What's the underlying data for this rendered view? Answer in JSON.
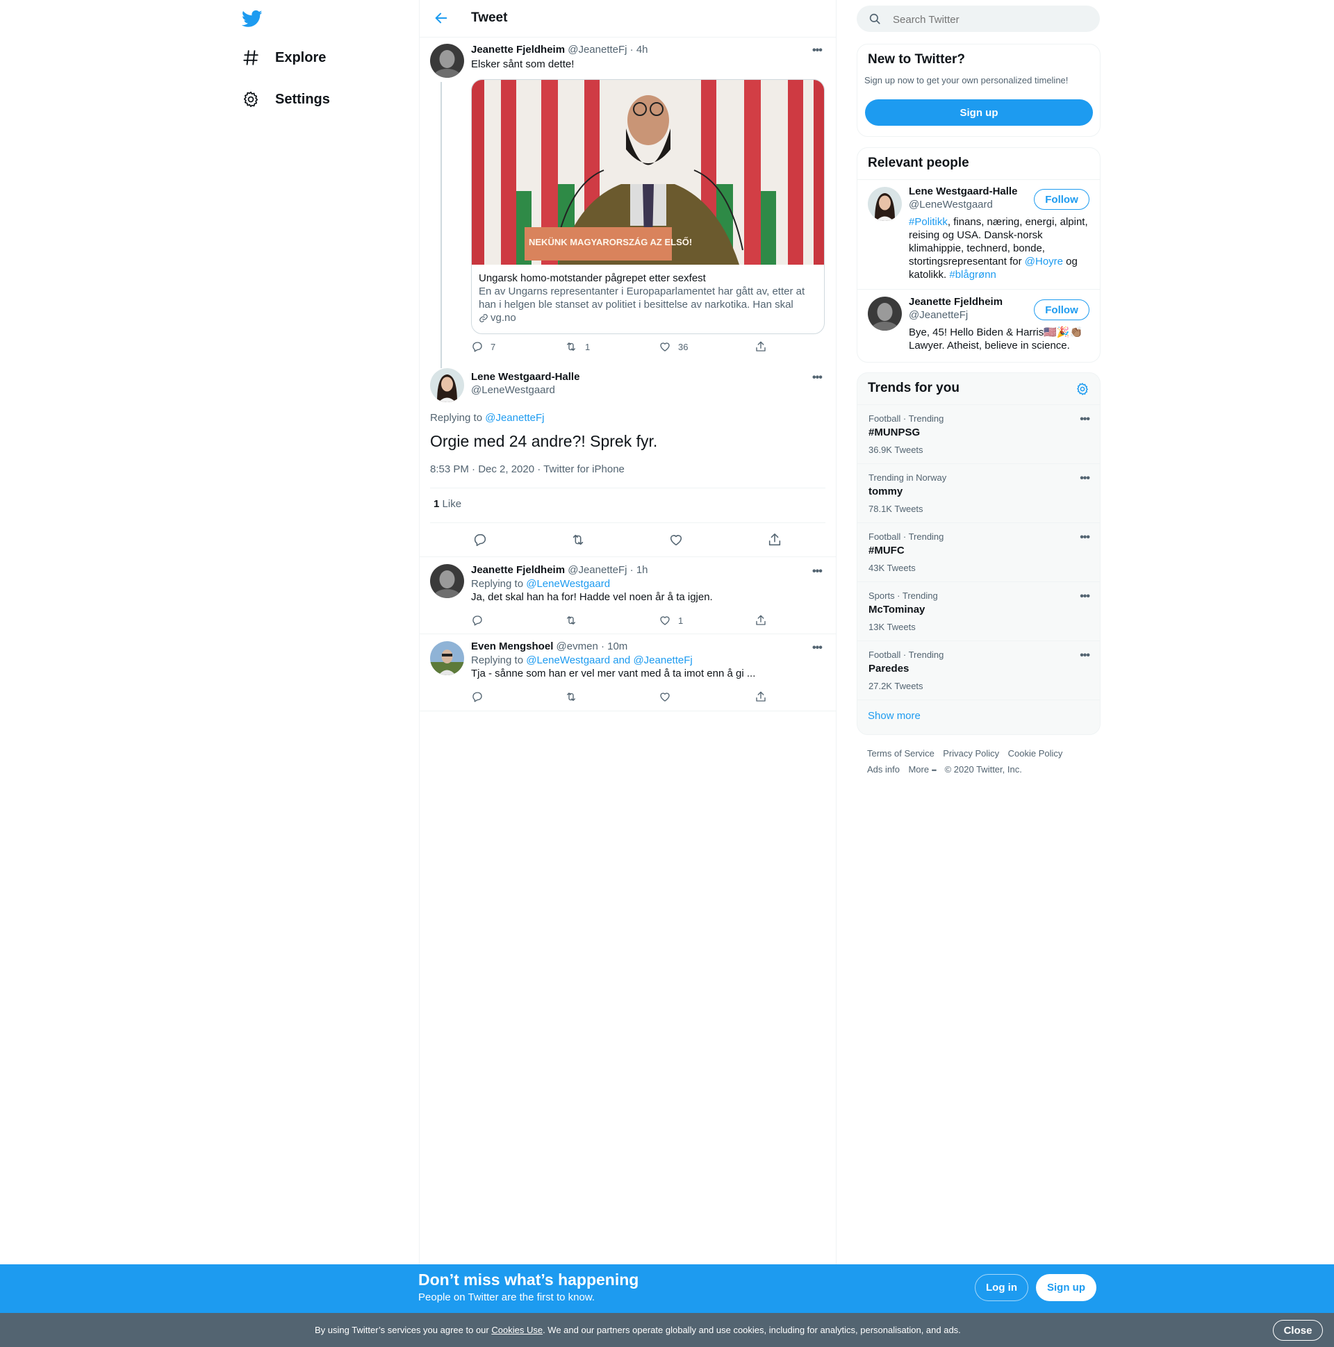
{
  "nav": {
    "logo": "twitter-bird",
    "items": [
      {
        "label": "Explore",
        "icon": "hashtag-icon"
      },
      {
        "label": "Settings",
        "icon": "gear-icon"
      }
    ]
  },
  "header": {
    "title": "Tweet"
  },
  "parent_tweet": {
    "author": "Jeanette Fjeldheim",
    "handle": "@JeanetteFj",
    "time": "· 4h",
    "text": "Elsker sånt som dette!",
    "card": {
      "image_caption": "NEKÜNK MAGYARORSZÁG AZ ELSŐ!",
      "title": "Ungarsk homo-motstander pågrepet etter sexfest",
      "description": "En av Ungarns representanter i Europaparlamentet har gått av, etter at han i helgen ble stanset av politiet i besittelse av narkotika. Han skal fø…",
      "domain": "vg.no"
    },
    "replies": "7",
    "retweets": "1",
    "likes": "36"
  },
  "main_tweet": {
    "author": "Lene Westgaard-Halle",
    "handle": "@LeneWestgaard",
    "replying_prefix": "Replying to",
    "replying_to": "@JeanetteFj",
    "text": "Orgie med 24 andre?! Sprek fyr.",
    "timestamp": "8:53 PM · Dec 2, 2020",
    "source": "Twitter for iPhone",
    "like_count": "1",
    "like_label": "Like"
  },
  "replies": [
    {
      "author": "Jeanette Fjeldheim",
      "handle": "@JeanetteFj",
      "time": "· 1h",
      "replying_prefix": "Replying to",
      "replying_to": "@LeneWestgaard",
      "text": "Ja, det skal han ha for! Hadde vel noen år å ta igjen.",
      "likes": "1"
    },
    {
      "author": "Even Mengshoel",
      "handle": "@evmen",
      "time": "· 10m",
      "replying_prefix": "Replying to",
      "replying_to": "@LeneWestgaard and @JeanetteFj",
      "text": "Tja - sånne som han er vel mer vant med å ta imot enn å gi ...",
      "likes": ""
    }
  ],
  "search": {
    "placeholder": "Search Twitter"
  },
  "new_to_twitter": {
    "title": "New to Twitter?",
    "subtitle": "Sign up now to get your own personalized timeline!",
    "button": "Sign up"
  },
  "relevant_people": {
    "title": "Relevant people",
    "people": [
      {
        "name": "Lene Westgaard-Halle",
        "handle": "@LeneWestgaard",
        "follow": "Follow",
        "bio_tag1": "#Politikk",
        "bio_text1": ", finans, næring, energi, alpint, reising og USA. Dansk-norsk klimahippie, technerd, bonde, stortingsrepresentant for ",
        "bio_mention": "@Hoyre",
        "bio_text2": " og katolikk. ",
        "bio_tag2": "#blågrønn"
      },
      {
        "name": "Jeanette Fjeldheim",
        "handle": "@JeanetteFj",
        "follow": "Follow",
        "bio_text": "Bye, 45! Hello Biden & Harris🇺🇸🎉👏🏽 Lawyer. Atheist, believe in science."
      }
    ]
  },
  "trends": {
    "title": "Trends for you",
    "items": [
      {
        "context": "Football · Trending",
        "name": "#MUNPSG",
        "count": "36.9K Tweets"
      },
      {
        "context": "Trending in Norway",
        "name": "tommy",
        "count": "78.1K Tweets"
      },
      {
        "context": "Football · Trending",
        "name": "#MUFC",
        "count": "43K Tweets"
      },
      {
        "context": "Sports · Trending",
        "name": "McTominay",
        "count": "13K Tweets"
      },
      {
        "context": "Football · Trending",
        "name": "Paredes",
        "count": "27.2K Tweets"
      }
    ],
    "show_more": "Show more"
  },
  "footer_links": {
    "terms": "Terms of Service",
    "privacy": "Privacy Policy",
    "cookie": "Cookie Policy",
    "ads": "Ads info",
    "more": "More",
    "copyright": "© 2020 Twitter, Inc."
  },
  "bottom_bar": {
    "title": "Don’t miss what’s happening",
    "subtitle": "People on Twitter are the first to know.",
    "login": "Log in",
    "signup": "Sign up"
  },
  "cookie_banner": {
    "text_before": "By using Twitter’s services you agree to our ",
    "link": "Cookies Use",
    "text_after": ". We and our partners operate globally and use cookies, including for analytics, personalisation, and ads.",
    "close": "Close"
  },
  "colors": {
    "accent": "#1d9bf0",
    "cookie_bg": "#536471",
    "text": "#0f1419",
    "muted": "#536471"
  }
}
